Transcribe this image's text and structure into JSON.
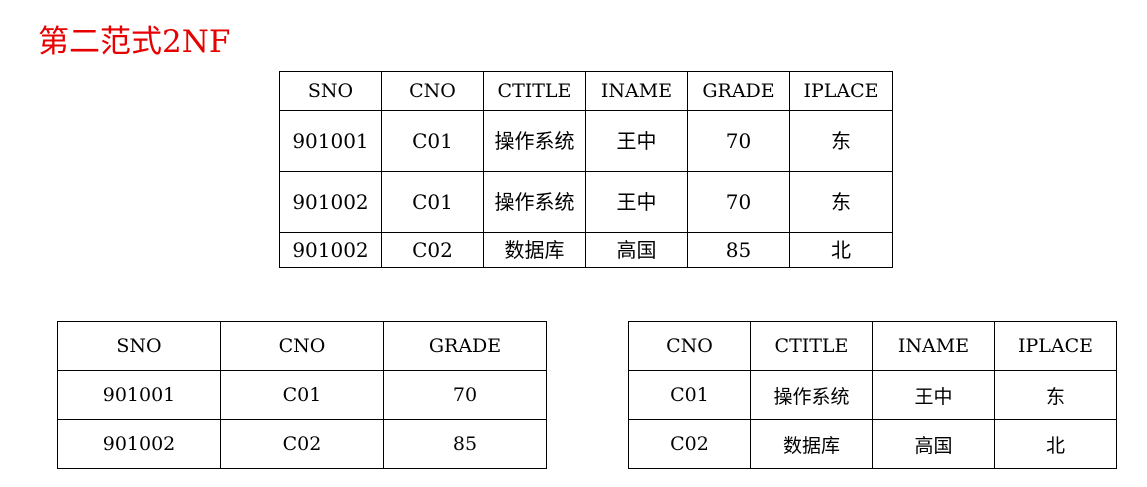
{
  "title": "第二范式2NF",
  "top_table": {
    "headers": [
      "SNO",
      "CNO",
      "CTITLE",
      "INAME",
      "GRADE",
      "IPLACE"
    ],
    "rows": [
      [
        "901001",
        "C01",
        "操作系统",
        "王中",
        "70",
        "东"
      ],
      [
        "901002",
        "C01",
        "操作系统",
        "王中",
        "70",
        "东"
      ],
      [
        "901002",
        "C02",
        "数据库",
        "高国",
        "85",
        "北"
      ]
    ]
  },
  "bottom_left_table": {
    "headers": [
      "SNO",
      "CNO",
      "GRADE"
    ],
    "rows": [
      [
        "901001",
        "C01",
        "70"
      ],
      [
        "901002",
        "C02",
        "85"
      ]
    ]
  },
  "bottom_right_table": {
    "headers": [
      "CNO",
      "CTITLE",
      "INAME",
      "IPLACE"
    ],
    "rows": [
      [
        "C01",
        "操作系统",
        "王中",
        "东"
      ],
      [
        "C02",
        "数据库",
        "高国",
        "北"
      ]
    ]
  },
  "colors": {
    "title": "#e60000",
    "border": "#000000",
    "text": "#000000"
  }
}
